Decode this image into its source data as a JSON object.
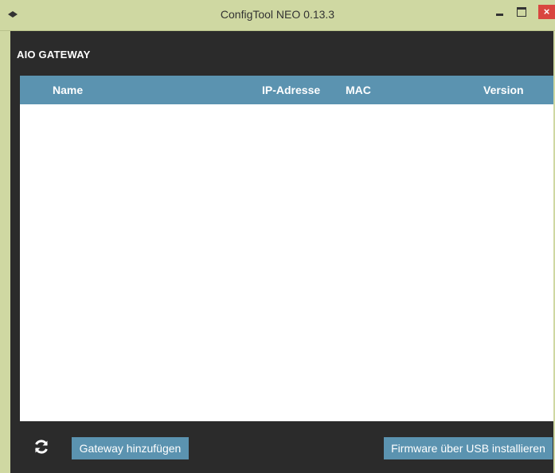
{
  "window": {
    "title": "ConfigTool NEO 0.13.3",
    "close_label": "×"
  },
  "section": {
    "title": "AIO GATEWAY"
  },
  "table": {
    "columns": [
      "Name",
      "IP-Adresse",
      "MAC",
      "Version"
    ],
    "rows": []
  },
  "footer": {
    "refresh_icon": "refresh-icon",
    "add_gateway_label": "Gateway hinzufügen",
    "firmware_usb_label": "Firmware über USB installieren"
  },
  "colors": {
    "titlebar": "#cfd8a2",
    "accent": "#5b93b0",
    "background": "#2b2b2b",
    "close": "#d9463f"
  }
}
